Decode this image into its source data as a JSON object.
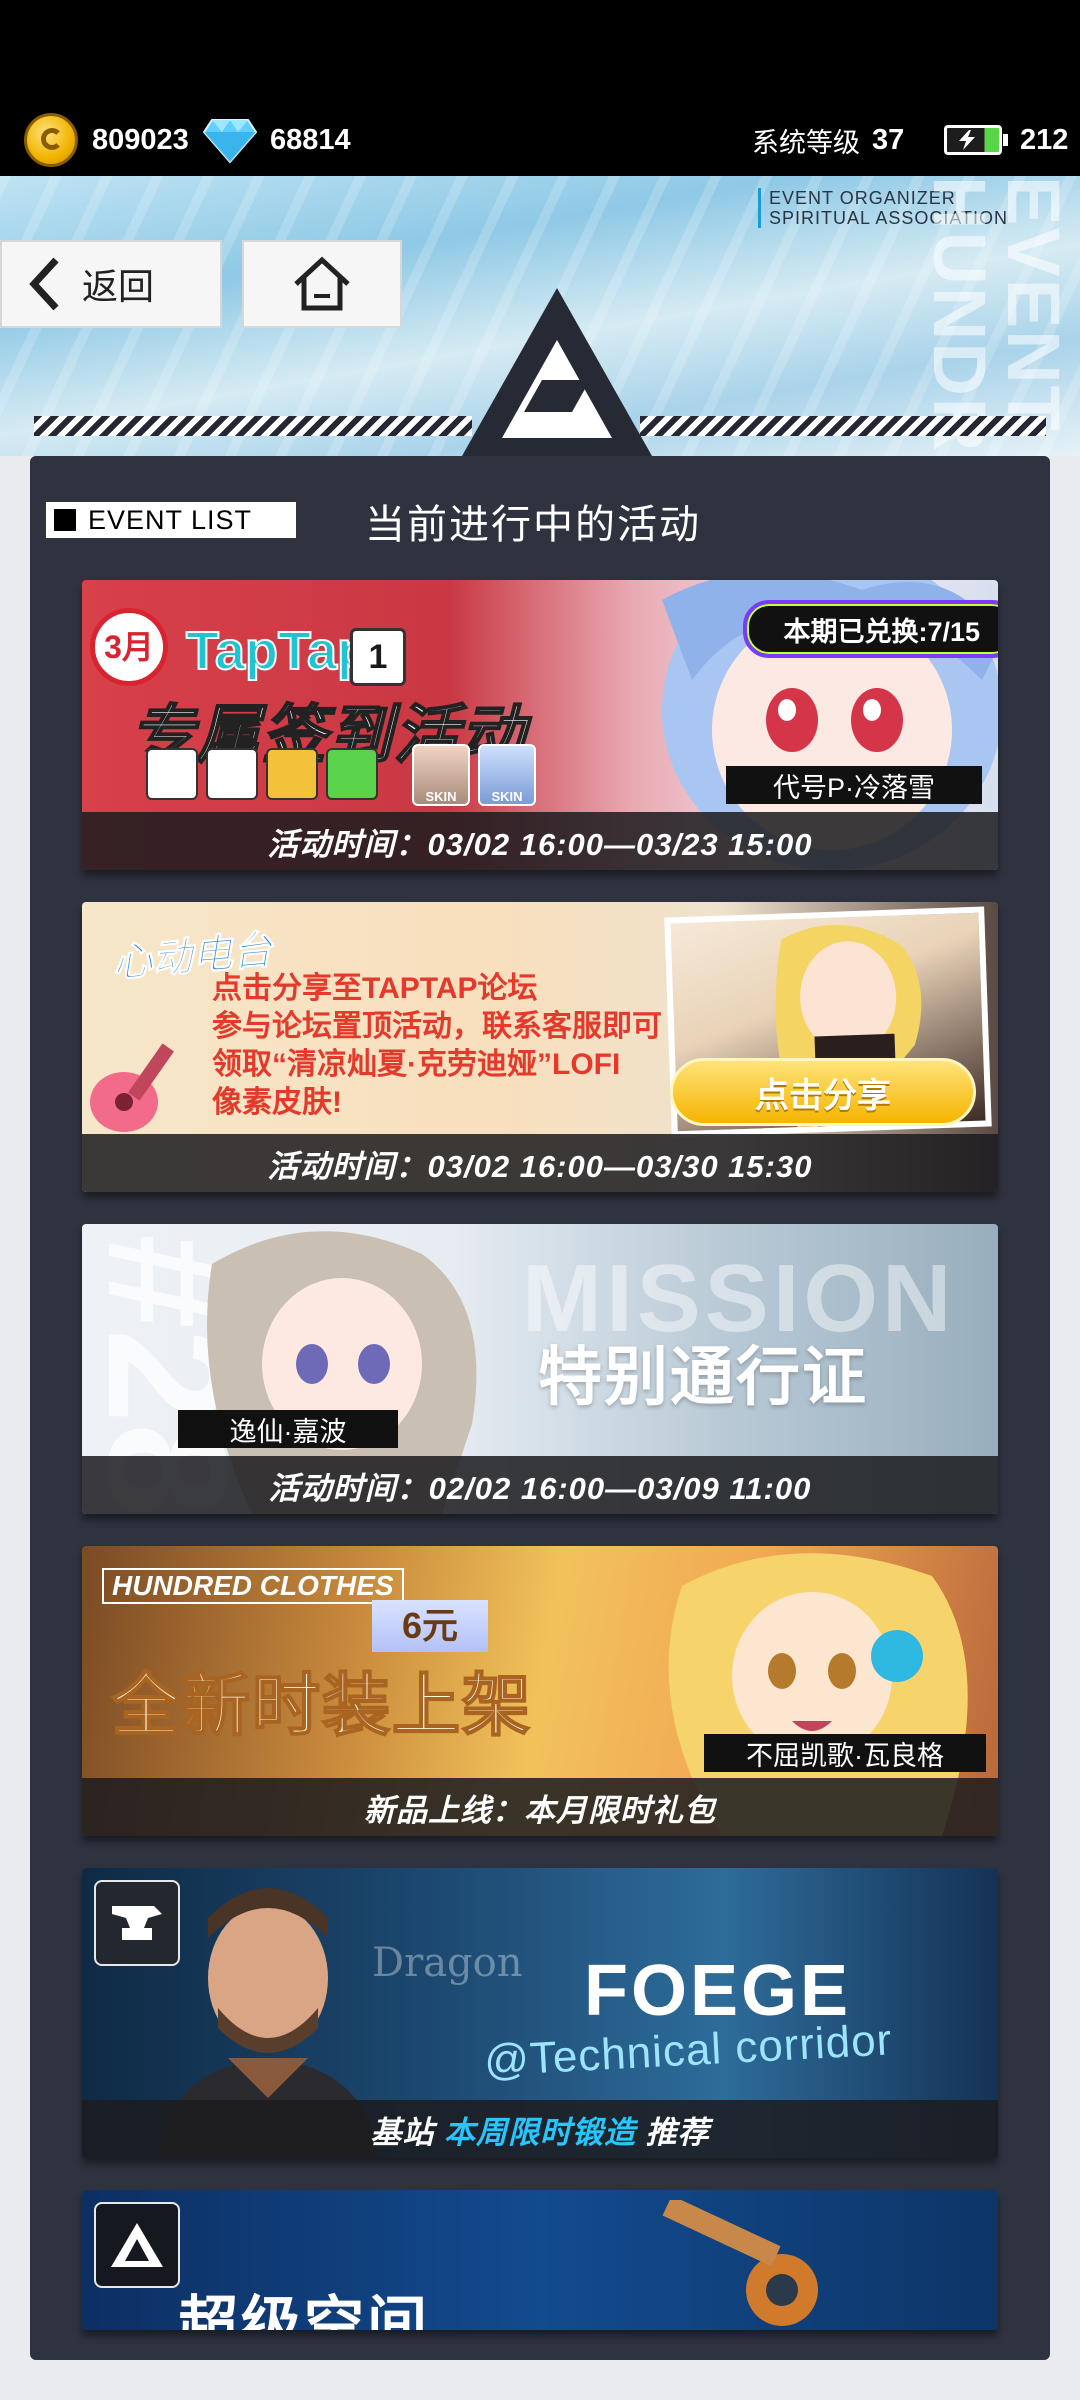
{
  "status": {
    "coins": "809023",
    "gems": "68814",
    "level_label": "系统等级",
    "level": "37",
    "energy": "212"
  },
  "header": {
    "org_line1": "EVENT ORGANIZER",
    "org_line2": "SPIRITUAL  ASSOCIATION",
    "vertical_text": "EVENT HUNDRED",
    "back_label": "返回"
  },
  "list": {
    "tag": "EVENT LIST",
    "title": "当前进行中的活动"
  },
  "cards": [
    {
      "month_badge": "3月",
      "brand": "TapTap",
      "cal_day": "1",
      "title": "专属签到活动",
      "skin_label": "SKIN",
      "redeem_pill": "本期已兑换:7/15",
      "character": "代号P·冷落雪",
      "time": "活动时间：03/02 16:00—03/23 15:00"
    },
    {
      "logo": "心动电台",
      "lines": [
        "点击分享至TAPTAP论坛",
        "参与论坛置顶活动，联系客服即可",
        "领取“清凉灿夏·克劳迪娅”LOFI",
        "像素皮肤!"
      ],
      "share_button": "点击分享",
      "time": "活动时间：03/02 16:00—03/30 15:30"
    },
    {
      "bg_number": "#28",
      "bg_word": "MISSION",
      "title": "特别通行证",
      "character": "逸仙·嘉波",
      "time": "活动时间：02/02 16:00—03/09 11:00"
    },
    {
      "brand": "HUNDRED CLOTHES",
      "price": "6元",
      "title": "全新时装上架",
      "character": "不屈凯歌·瓦良格",
      "time": "新品上线：本月限时礼包"
    },
    {
      "dragon_text": "Dragon",
      "title": "FOEGE",
      "subtitle": "@Technical corridor",
      "time_prefix": "基站",
      "time_highlight": "本周限时锻造",
      "time_suffix": "推荐"
    },
    {
      "title": "超级空间"
    }
  ],
  "colors": {
    "panel": "#2f3340",
    "accent_blue": "#27c6ff",
    "pill_border": "#7a3df5",
    "share_button": "#f5b400"
  }
}
